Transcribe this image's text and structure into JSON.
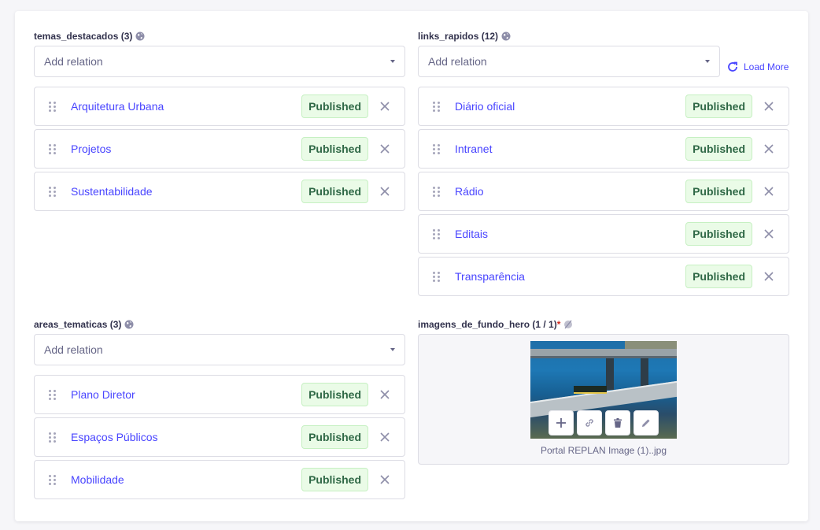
{
  "fields": [
    {
      "label": "temas_destacados (3)",
      "placeholder": "Add relation",
      "items": [
        {
          "name": "Arquitetura Urbana",
          "status": "Published"
        },
        {
          "name": "Projetos",
          "status": "Published"
        },
        {
          "name": "Sustentabilidade",
          "status": "Published"
        }
      ]
    },
    {
      "label": "links_rapidos (12)",
      "placeholder": "Add relation",
      "load_more": "Load More",
      "items": [
        {
          "name": "Diário oficial",
          "status": "Published"
        },
        {
          "name": "Intranet",
          "status": "Published"
        },
        {
          "name": "Rádio",
          "status": "Published"
        },
        {
          "name": "Editais",
          "status": "Published"
        },
        {
          "name": "Transparência",
          "status": "Published"
        }
      ]
    },
    {
      "label": "areas_tematicas (3)",
      "placeholder": "Add relation",
      "items": [
        {
          "name": "Plano Diretor",
          "status": "Published"
        },
        {
          "name": "Espaços Públicos",
          "status": "Published"
        },
        {
          "name": "Mobilidade",
          "status": "Published"
        }
      ]
    },
    {
      "label": "imagens_de_fundo_hero (1 / 1)",
      "required_mark": "*",
      "file_name": "Portal REPLAN Image (1)..jpg"
    }
  ],
  "colors": {
    "primary": "#4945ff",
    "success_text": "#2f6846",
    "success_bg": "#eafbe7",
    "border": "#dcdce4",
    "required": "#d02b20"
  }
}
